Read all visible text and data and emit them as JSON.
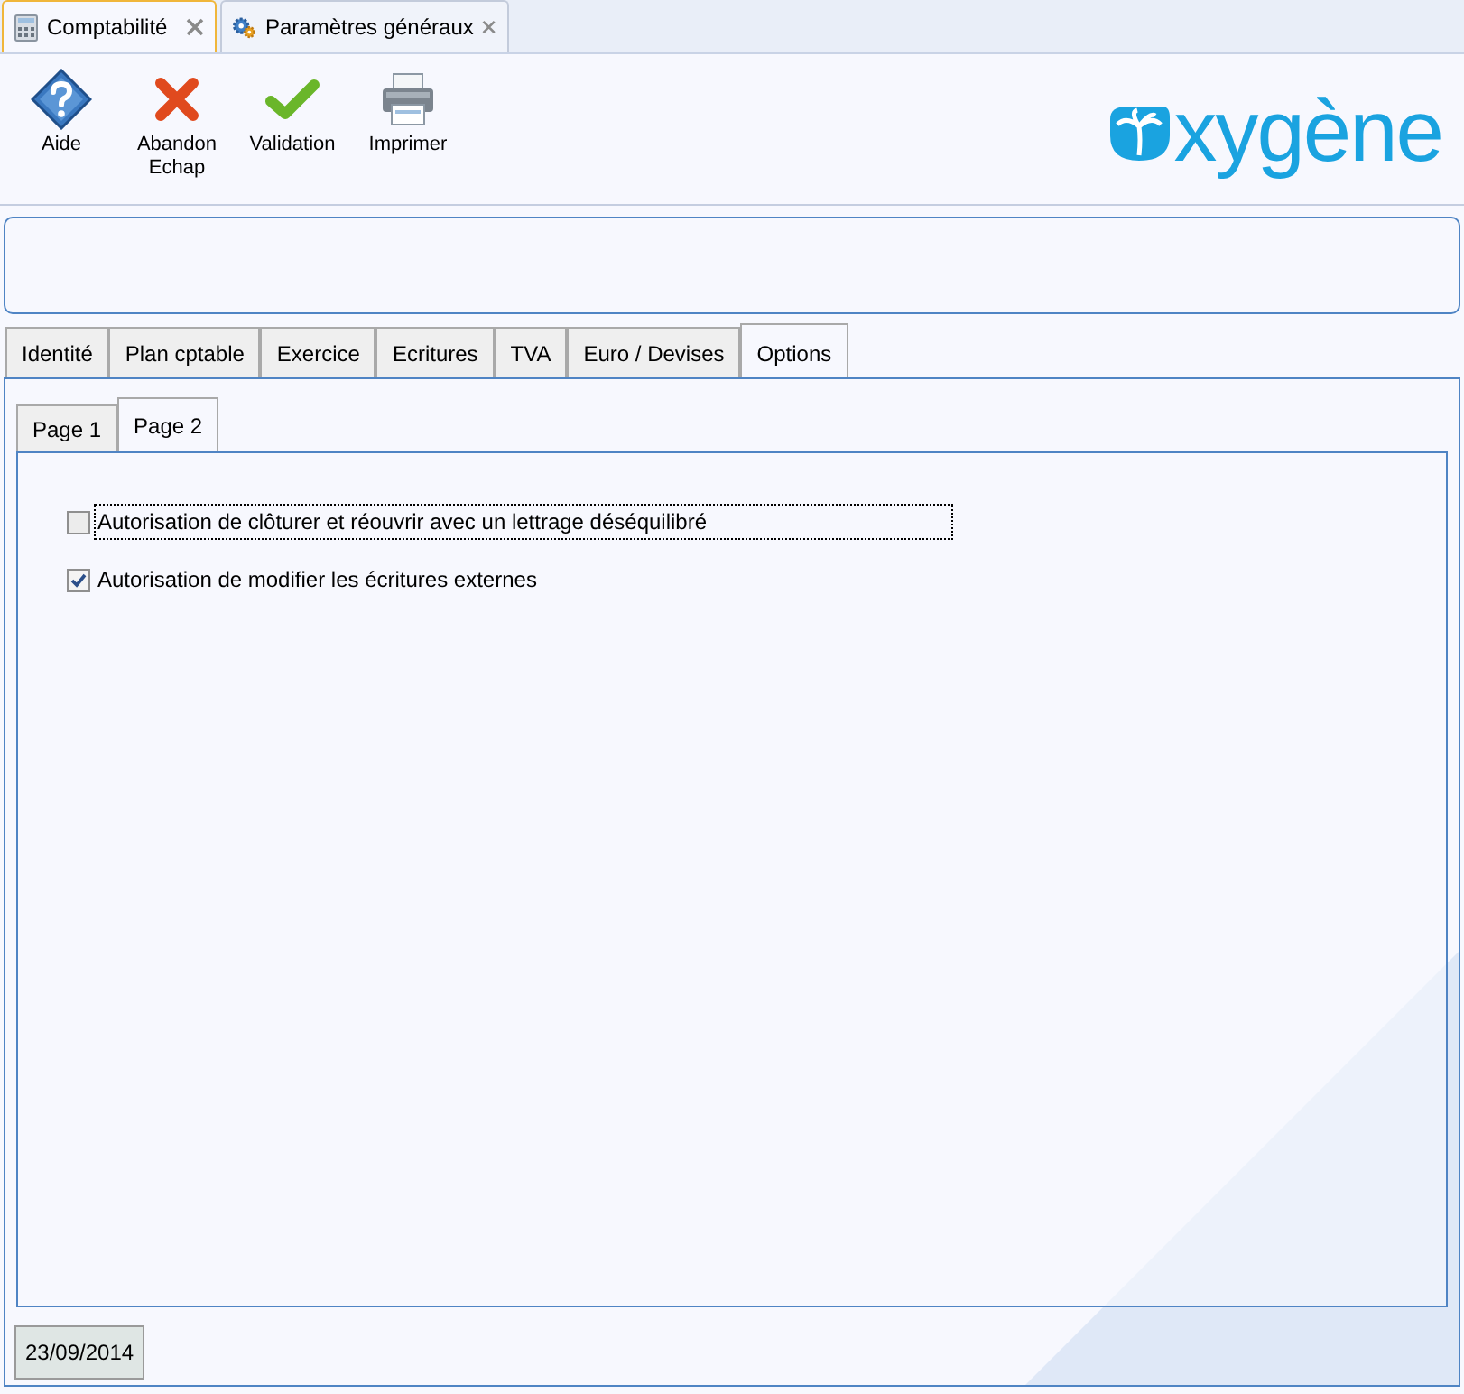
{
  "doc_tabs": [
    {
      "label": "Comptabilité",
      "selected": true,
      "kind": "calculator"
    },
    {
      "label": "Paramètres généraux",
      "selected": false,
      "kind": "gears"
    }
  ],
  "toolbar": [
    {
      "label": "Aide",
      "kind": "help"
    },
    {
      "label": "Abandon\nEchap",
      "kind": "cancel"
    },
    {
      "label": "Validation",
      "kind": "check"
    },
    {
      "label": "Imprimer",
      "kind": "print"
    }
  ],
  "logo": {
    "text": "xygène"
  },
  "tabs": [
    {
      "label": "Identité",
      "selected": false
    },
    {
      "label": "Plan cptable",
      "selected": false
    },
    {
      "label": "Exercice",
      "selected": false
    },
    {
      "label": "Ecritures",
      "selected": false
    },
    {
      "label": "TVA",
      "selected": false
    },
    {
      "label": "Euro / Devises",
      "selected": false
    },
    {
      "label": "Options",
      "selected": true
    }
  ],
  "sub_tabs": [
    {
      "label": "Page 1",
      "selected": false
    },
    {
      "label": "Page 2",
      "selected": true
    }
  ],
  "options": [
    {
      "label": "Autorisation de clôturer et réouvrir avec un lettrage déséquilibré",
      "checked": false,
      "focused": true
    },
    {
      "label": "Autorisation de modifier les écritures externes",
      "checked": true,
      "focused": false
    }
  ],
  "status": {
    "date": "23/09/2014"
  }
}
